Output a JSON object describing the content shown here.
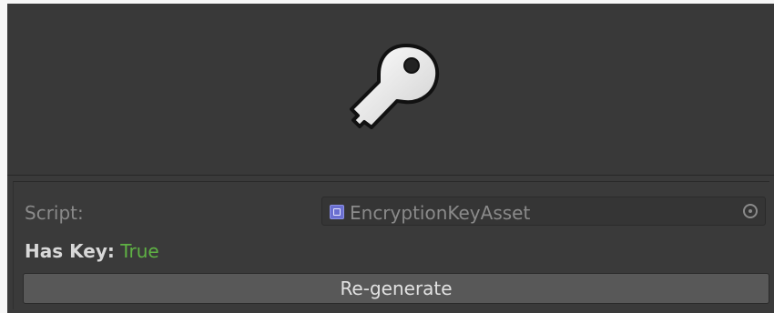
{
  "inspector": {
    "script_label": "Script:",
    "script_value": "EncryptionKeyAsset",
    "has_key_label": "Has Key:",
    "has_key_value": "True",
    "regenerate_label": "Re-generate"
  },
  "icons": {
    "preview": "key-icon",
    "script": "script-asset-icon",
    "picker": "object-picker-icon"
  },
  "colors": {
    "background": "#383838",
    "true_value": "#5fb244",
    "button": "#585858"
  }
}
